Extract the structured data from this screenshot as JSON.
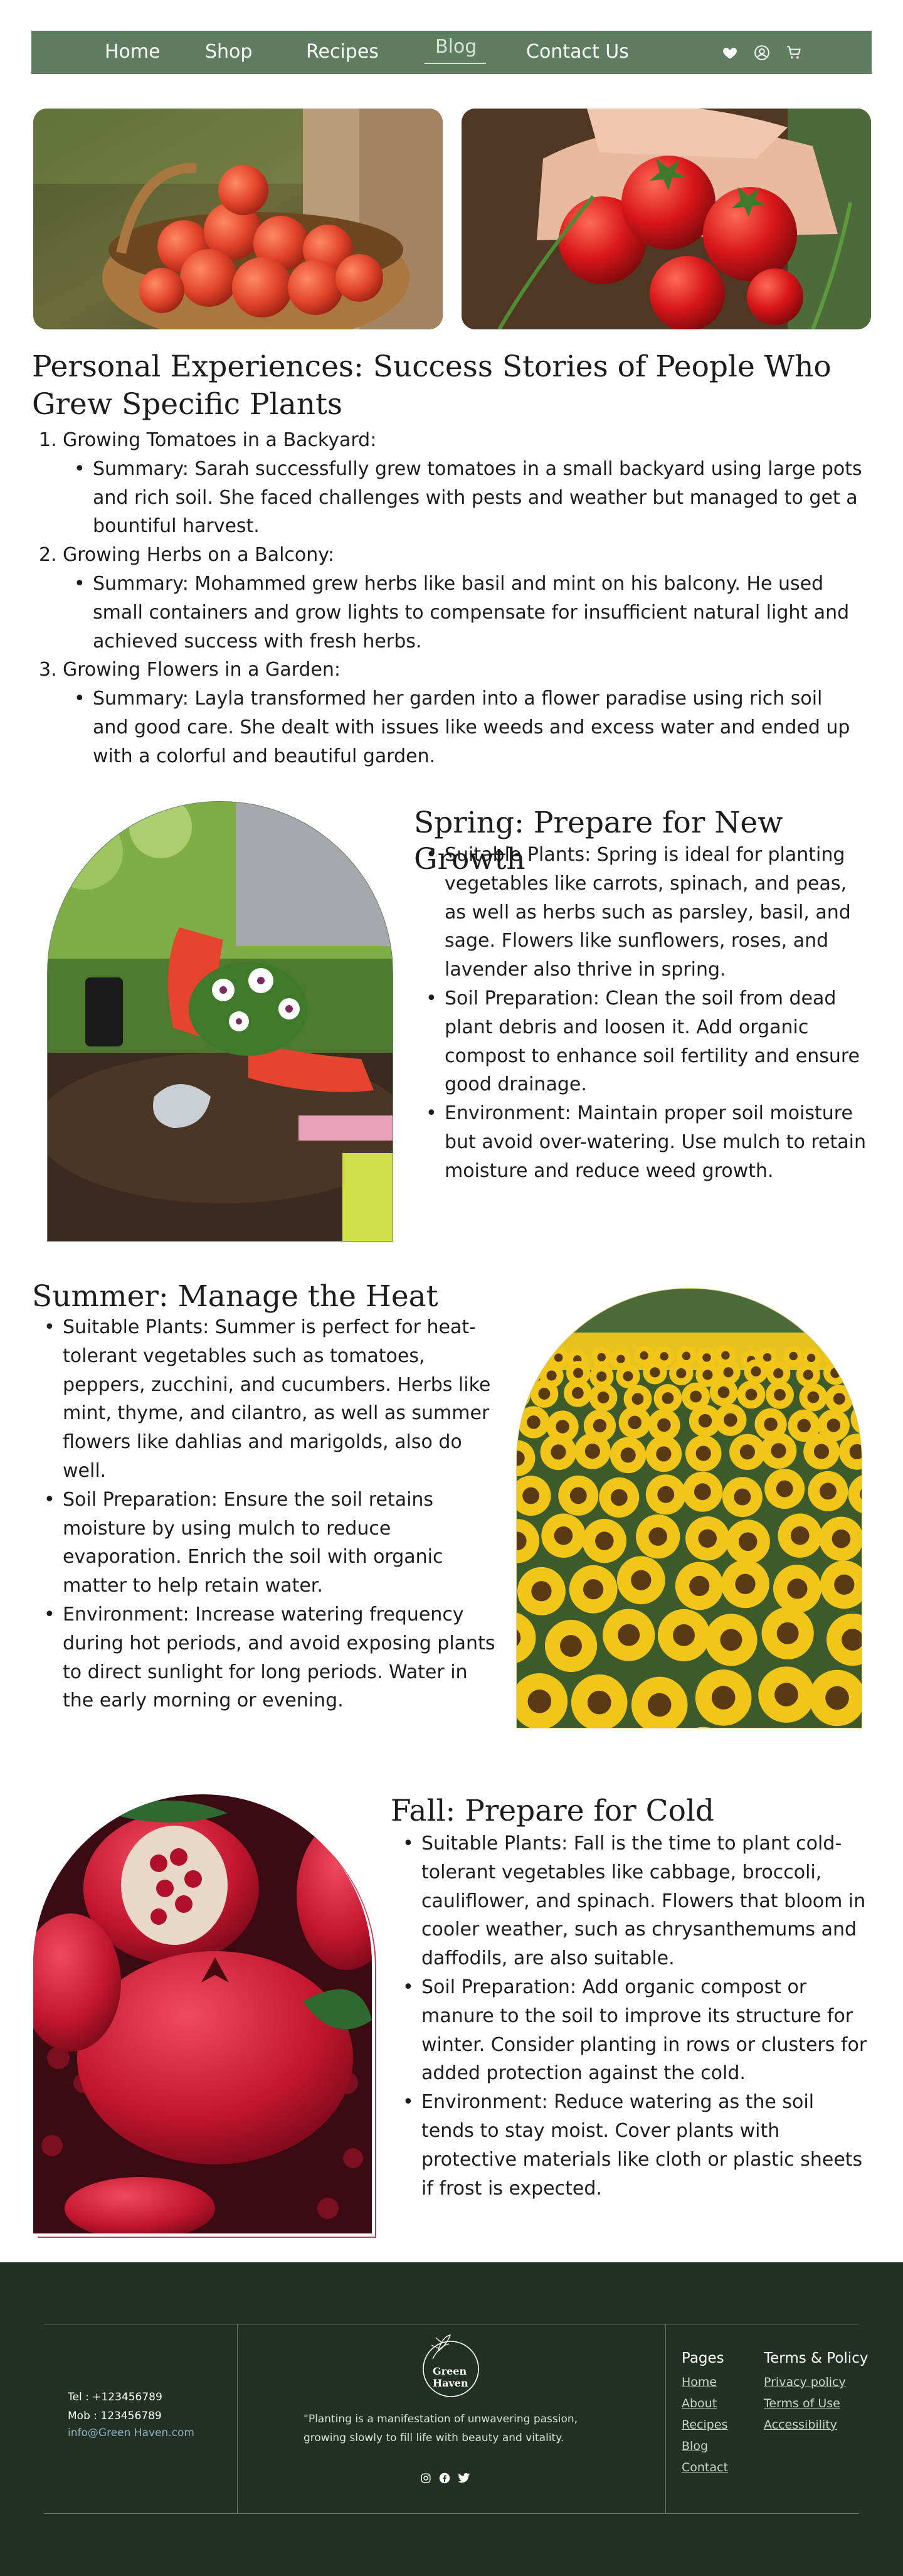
{
  "nav": {
    "items": [
      "Home",
      "Shop",
      "Recipes",
      "Blog",
      "Contact Us"
    ],
    "active": "Blog"
  },
  "experiences": {
    "title": "Personal Experiences: Success Stories of People Who Grew Specific Plants",
    "items": [
      {
        "number": "1.",
        "heading": "Growing Tomatoes in a Backyard:",
        "summary": "Summary: Sarah successfully grew tomatoes in a small backyard using large pots and rich soil. She faced challenges with pests and weather but managed to get a bountiful harvest."
      },
      {
        "number": "2.",
        "heading": "Growing Herbs on a Balcony:",
        "summary": "Summary: Mohammed grew herbs like basil and mint on his balcony. He used small containers and grow lights to compensate for insufficient natural light and achieved success with fresh herbs."
      },
      {
        "number": "3.",
        "heading": "Growing Flowers in a Garden:",
        "summary": "Summary: Layla transformed her garden into a flower paradise using rich soil and good care. She dealt with issues like weeds and excess water and ended up with a colorful and beautiful garden."
      }
    ]
  },
  "spring": {
    "title": "Spring: Prepare for New Growth",
    "bullets": [
      "Suitable Plants: Spring is ideal for planting vegetables like carrots, spinach, and peas, as well as herbs such as parsley, basil, and sage. Flowers like sunflowers, roses, and lavender also thrive in spring.",
      "Soil Preparation: Clean the soil from dead plant debris and loosen it. Add organic compost to enhance soil fertility and ensure good drainage.",
      "Environment: Maintain proper soil moisture but avoid over-watering. Use mulch to retain moisture and reduce weed growth."
    ]
  },
  "summer": {
    "title": "Summer: Manage the Heat",
    "bullets": [
      "Suitable Plants: Summer is perfect for heat-tolerant vegetables such as tomatoes, peppers, zucchini, and cucumbers. Herbs like mint, thyme, and cilantro, as well as summer flowers like dahlias and marigolds, also do well.",
      "Soil Preparation: Ensure the soil retains moisture by using mulch to reduce evaporation. Enrich the soil with organic matter to help retain water.",
      "Environment: Increase watering frequency during hot periods, and avoid exposing plants to direct sunlight for long periods. Water in the early morning or evening."
    ]
  },
  "fall": {
    "title": "Fall: Prepare for Cold",
    "bullets": [
      "Suitable Plants: Fall is the time to plant cold-tolerant vegetables like cabbage, broccoli, cauliflower, and spinach. Flowers that bloom in cooler weather, such as chrysanthemums and daffodils, are also suitable.",
      "Soil Preparation: Add organic compost or manure to the soil to improve its structure for winter. Consider planting in rows or clusters for added protection against the cold.",
      "Environment: Reduce watering as the soil tends to stay moist. Cover plants with protective materials like cloth or plastic sheets if frost is expected."
    ]
  },
  "footer": {
    "tel": "Tel : +123456789",
    "mob": "Mob : 123456789",
    "email": "info@Green Haven.com",
    "logo_text": "Green Haven",
    "quote_line1": "\"Planting is a manifestation of unwavering passion,",
    "quote_line2": "growing slowly to fill life with beauty and vitality.",
    "pages_title": "Pages",
    "pages": [
      "Home",
      "About",
      "Recipes",
      "Blog",
      "Contact"
    ],
    "terms_title": "Terms & Policy",
    "terms": [
      "Privacy policy",
      "Terms of Use",
      "Accessibility"
    ]
  },
  "colors": {
    "nav_bg": "#5f7d60",
    "footer_bg": "#223124",
    "summer_frame": "#e8d27a",
    "fall_frame": "#c23a57"
  }
}
